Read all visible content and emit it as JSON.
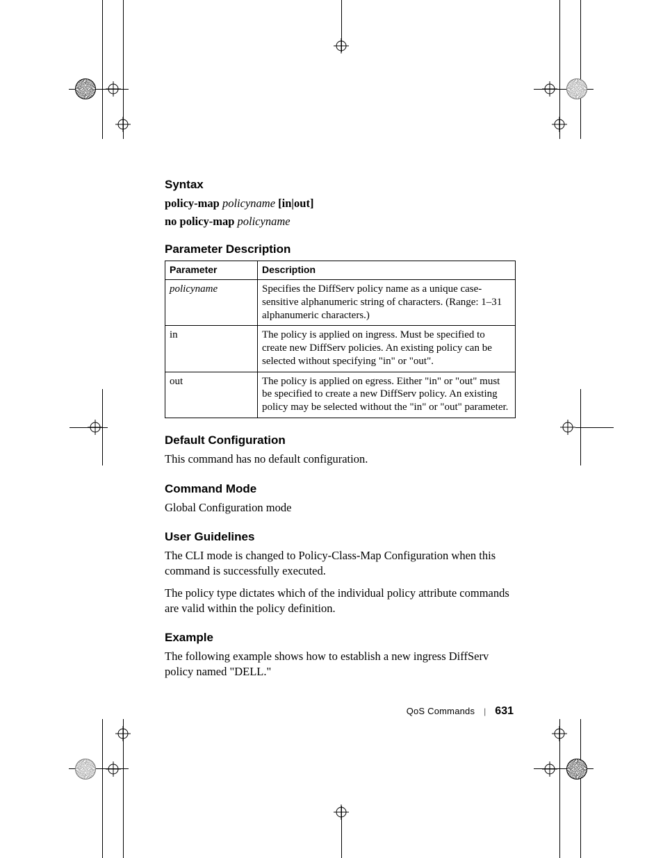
{
  "sections": {
    "syntax": {
      "heading": "Syntax",
      "line1_bold": "policy-map",
      "line1_ital": "policyname",
      "line1_tail": " [in|out]",
      "line2_bold": "no policy-map",
      "line2_ital": "policyname"
    },
    "param_desc": {
      "heading": "Parameter Description",
      "col1": "Parameter",
      "col2": "Description",
      "rows": [
        {
          "p": "policyname",
          "p_italic": true,
          "d": "Specifies the DiffServ policy name as a unique case-sensitive alphanumeric string of characters. (Range: 1–31 alphanumeric characters.)"
        },
        {
          "p": "in",
          "p_italic": false,
          "d": "The policy is applied on ingress. Must be specified to create new DiffServ policies. An existing policy can be selected without specifying \"in\" or \"out\"."
        },
        {
          "p": "out",
          "p_italic": false,
          "d": "The policy is applied on egress. Either \"in\" or \"out\" must be specified to create a new DiffServ policy. An existing policy may be selected without the \"in\" or \"out\" parameter."
        }
      ]
    },
    "default_cfg": {
      "heading": "Default Configuration",
      "body": "This command has no default configuration."
    },
    "cmd_mode": {
      "heading": "Command Mode",
      "body": "Global Configuration mode"
    },
    "user_guidelines": {
      "heading": "User Guidelines",
      "p1": "The CLI mode is changed to Policy-Class-Map Configuration when this command is successfully executed.",
      "p2": "The policy type dictates which of the individual policy attribute commands are valid within the policy definition."
    },
    "example": {
      "heading": "Example",
      "body": "The following example shows how to establish a new ingress DiffServ policy named \"DELL.\""
    }
  },
  "footer": {
    "section_label": "QoS Commands",
    "page_number": "631"
  }
}
